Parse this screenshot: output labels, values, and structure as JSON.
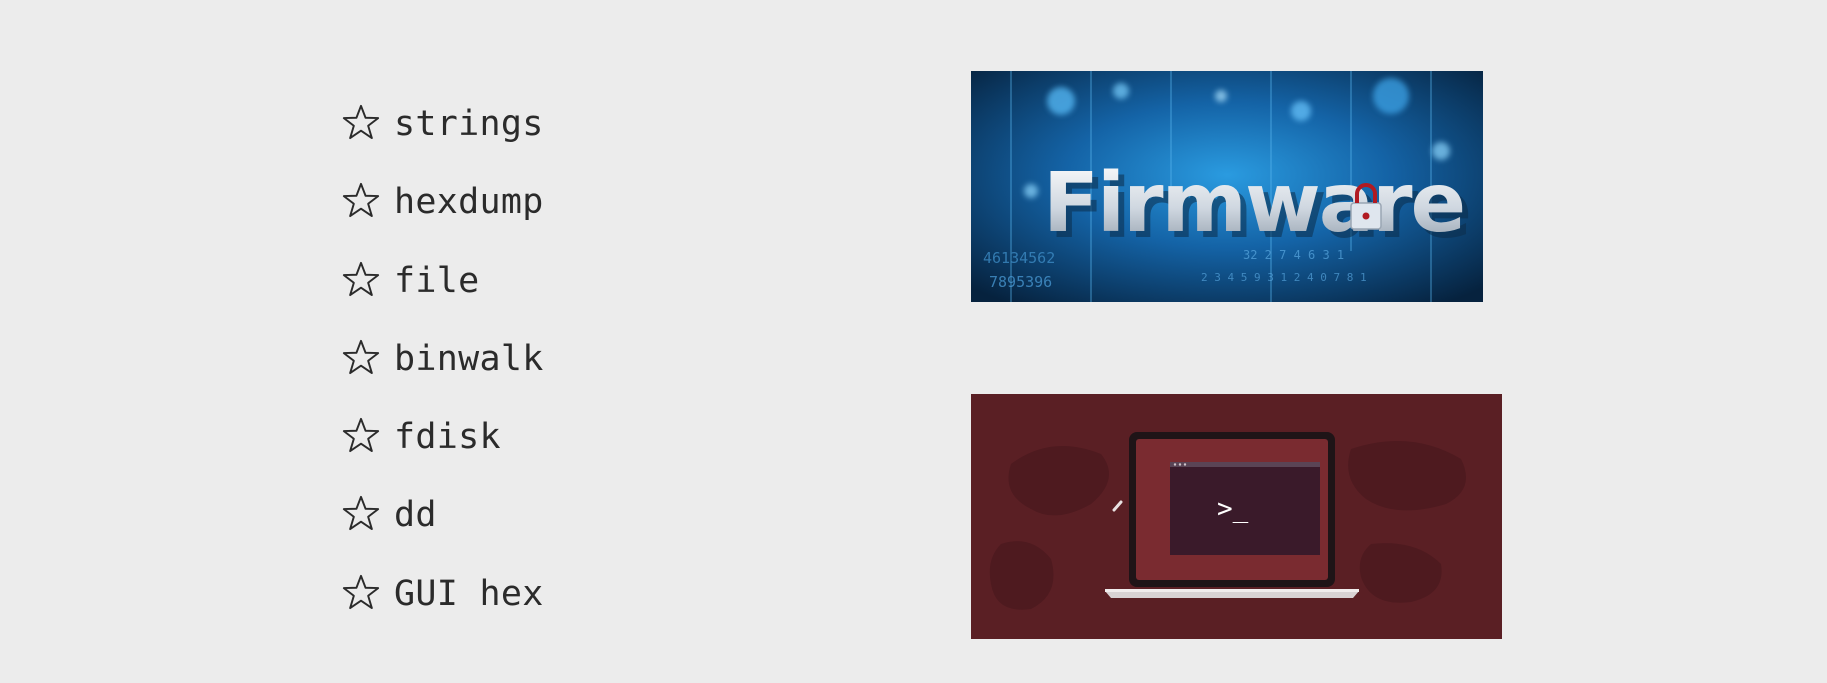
{
  "tools": [
    {
      "label": "strings"
    },
    {
      "label": "hexdump"
    },
    {
      "label": "file"
    },
    {
      "label": "binwalk"
    },
    {
      "label": "fdisk"
    },
    {
      "label": "dd"
    },
    {
      "label": "GUI hex"
    }
  ],
  "firmware_image": {
    "word": "Firmware",
    "digits_left": "46134562",
    "digits_left_2": "7895396",
    "digits_right": "32 2 7 4 6 3 1",
    "digits_right_2": "2 3 4 5 9 3 1 2 4 0 7 8 1"
  },
  "terminal_image": {
    "prompt": ">_"
  },
  "colors": {
    "background": "#ececec",
    "text": "#2b2b2b",
    "firmware_blue": "#1a78c2",
    "terminal_maroon": "#5a1f24",
    "laptop_red": "#7a2b30",
    "terminal_dark": "#3a1a2a"
  }
}
